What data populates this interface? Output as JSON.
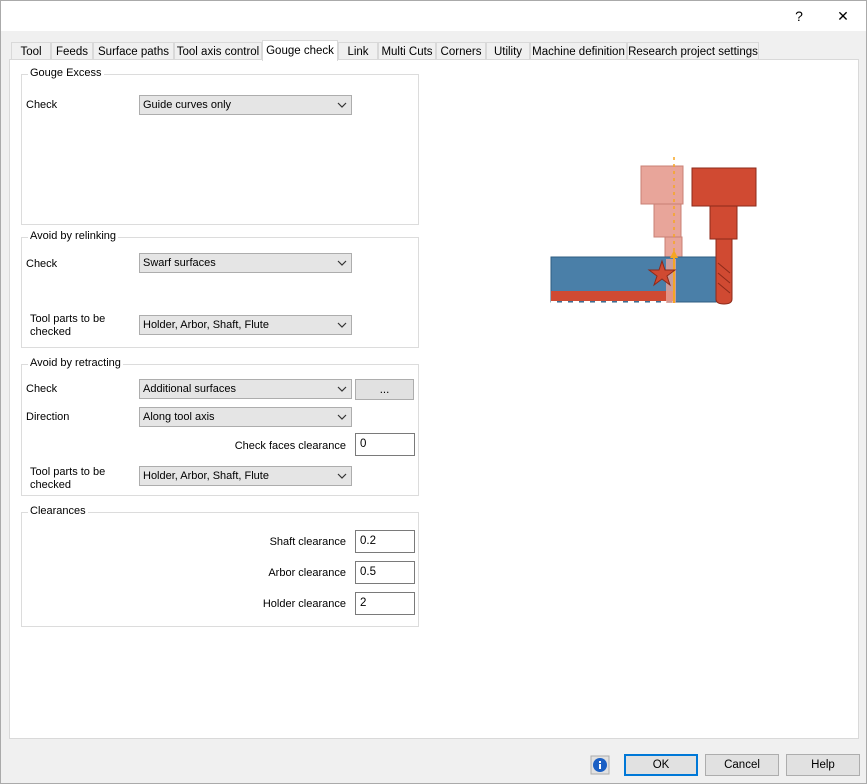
{
  "titlebar": {
    "help_label": "?",
    "close_label": "✕"
  },
  "tabs": [
    {
      "label": "Tool"
    },
    {
      "label": "Feeds"
    },
    {
      "label": "Surface paths"
    },
    {
      "label": "Tool axis control"
    },
    {
      "label": "Gouge check"
    },
    {
      "label": "Link"
    },
    {
      "label": "Multi Cuts"
    },
    {
      "label": "Corners"
    },
    {
      "label": "Utility"
    },
    {
      "label": "Machine definition"
    },
    {
      "label": "Research project settings"
    }
  ],
  "active_tab": "Gouge check",
  "gouge_excess": {
    "title": "Gouge Excess",
    "check_label": "Check",
    "check_value": "Guide curves only"
  },
  "avoid_relinking": {
    "title": "Avoid by relinking",
    "check_label": "Check",
    "check_value": "Swarf surfaces",
    "tool_parts_label_1": "Tool parts to be",
    "tool_parts_label_2": "checked",
    "tool_parts_value": "Holder, Arbor, Shaft, Flute"
  },
  "avoid_retracting": {
    "title": "Avoid by retracting",
    "check_label": "Check",
    "check_value": "Additional surfaces",
    "more_button": "...",
    "direction_label": "Direction",
    "direction_value": "Along tool axis",
    "check_faces_label": "Check faces clearance",
    "check_faces_value": "0",
    "tool_parts_label_1": "Tool parts to be",
    "tool_parts_label_2": "checked",
    "tool_parts_value": "Holder, Arbor, Shaft, Flute"
  },
  "clearances": {
    "title": "Clearances",
    "shaft_label": "Shaft clearance",
    "shaft_value": "0.2",
    "arbor_label": "Arbor clearance",
    "arbor_value": "0.5",
    "holder_label": "Holder clearance",
    "holder_value": "2"
  },
  "footer": {
    "ok": "OK",
    "cancel": "Cancel",
    "help": "Help"
  },
  "colors": {
    "accent": "#0078d7",
    "tool_red": "#d04a32",
    "tool_light": "#e8a59a",
    "part_blue": "#4a7fa8",
    "star_red": "#d04a32",
    "arrow_yellow": "#f5a623"
  }
}
